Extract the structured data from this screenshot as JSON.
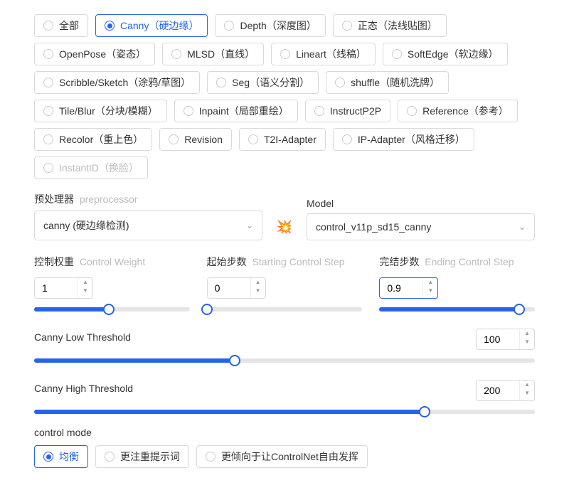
{
  "control_types": [
    {
      "label": "全部",
      "selected": false
    },
    {
      "label": "Canny（硬边缘）",
      "selected": true
    },
    {
      "label": "Depth（深度图）",
      "selected": false
    },
    {
      "label": "正态（法线贴图）",
      "selected": false
    },
    {
      "label": "OpenPose（姿态）",
      "selected": false
    },
    {
      "label": "MLSD（直线）",
      "selected": false
    },
    {
      "label": "Lineart（线稿）",
      "selected": false
    },
    {
      "label": "SoftEdge（软边缘）",
      "selected": false
    },
    {
      "label": "Scribble/Sketch（涂鸦/草图）",
      "selected": false
    },
    {
      "label": "Seg（语义分割）",
      "selected": false
    },
    {
      "label": "shuffle（随机洗牌）",
      "selected": false
    },
    {
      "label": "Tile/Blur（分块/模糊）",
      "selected": false
    },
    {
      "label": "Inpaint（局部重绘）",
      "selected": false
    },
    {
      "label": "InstructP2P",
      "selected": false
    },
    {
      "label": "Reference（参考）",
      "selected": false
    },
    {
      "label": "Recolor（重上色）",
      "selected": false
    },
    {
      "label": "Revision",
      "selected": false
    },
    {
      "label": "T2I-Adapter",
      "selected": false
    },
    {
      "label": "IP-Adapter（风格迁移）",
      "selected": false
    },
    {
      "label": "InstantID（换脸）",
      "selected": false,
      "disabled": true
    }
  ],
  "preprocessor": {
    "label_cn": "预处理器",
    "label_en": "preprocessor",
    "value": "canny (硬边缘检测)"
  },
  "model": {
    "label_cn": "Model",
    "value": "control_v11p_sd15_canny"
  },
  "fire_icon": "💥",
  "weight": {
    "label_cn": "控制权重",
    "label_en": "Control Weight",
    "value": "1",
    "fill_pct": 48
  },
  "start": {
    "label_cn": "起始步数",
    "label_en": "Starting Control Step",
    "value": "0",
    "fill_pct": 0
  },
  "end": {
    "label_cn": "完结步数",
    "label_en": "Ending Control Step",
    "value": "0.9",
    "fill_pct": 90,
    "active": true
  },
  "canny_low": {
    "label": "Canny Low Threshold",
    "value": "100",
    "fill_pct": 40
  },
  "canny_high": {
    "label": "Canny High Threshold",
    "value": "200",
    "fill_pct": 78
  },
  "control_mode": {
    "label": "control mode",
    "options": [
      {
        "label": "均衡",
        "selected": true
      },
      {
        "label": "更注重提示词",
        "selected": false
      },
      {
        "label": "更倾向于让ControlNet自由发挥",
        "selected": false
      }
    ]
  }
}
